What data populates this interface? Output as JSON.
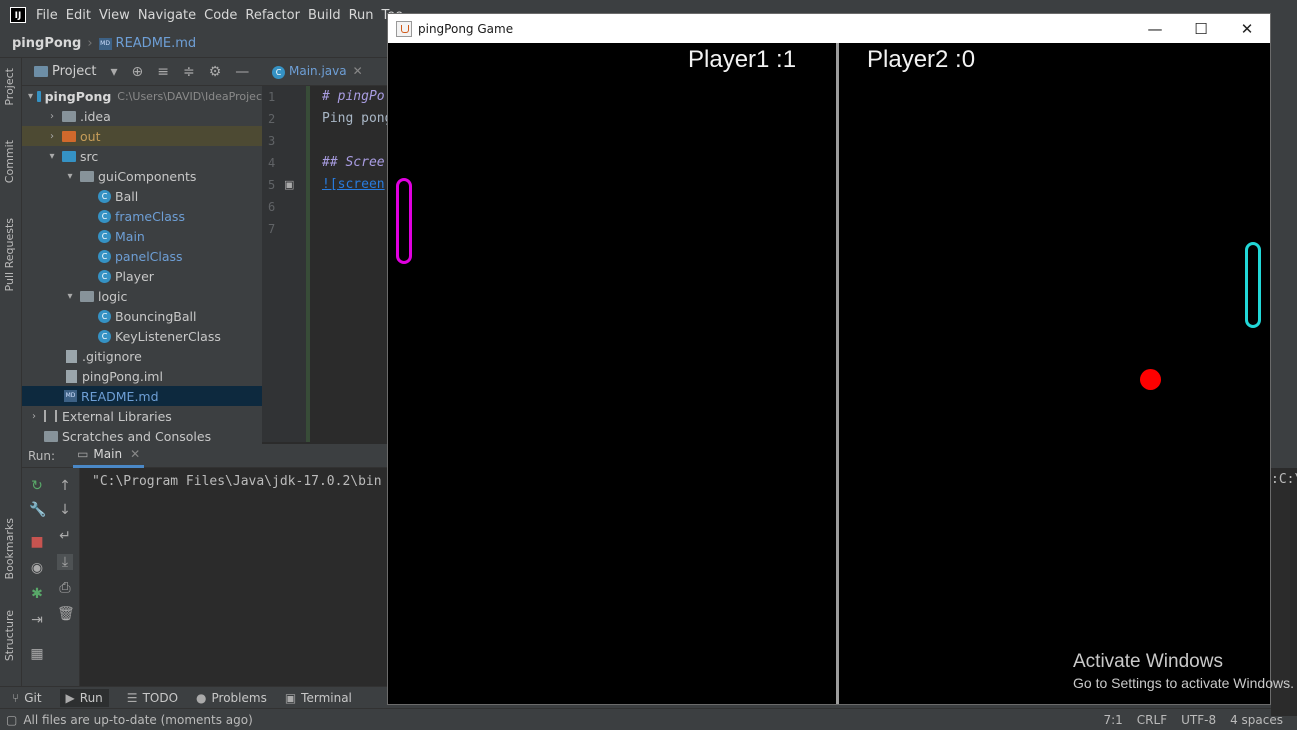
{
  "ide": {
    "menu": [
      "File",
      "Edit",
      "View",
      "Navigate",
      "Code",
      "Refactor",
      "Build",
      "Run",
      "Too"
    ],
    "nav": {
      "project": "pingPong",
      "file": "README.md"
    },
    "left_tabs": [
      "Project",
      "Commit",
      "Pull Requests",
      "Bookmarks",
      "Structure"
    ],
    "project_panel": {
      "title": "Project",
      "tree": [
        {
          "label": "pingPong",
          "path": "C:\\Users\\DAVID\\IdeaProjec",
          "level": 0
        },
        {
          "label": ".idea",
          "level": 1
        },
        {
          "label": "out",
          "level": 1
        },
        {
          "label": "src",
          "level": 1
        },
        {
          "label": "guiComponents",
          "level": 2
        },
        {
          "label": "Ball",
          "level": 3
        },
        {
          "label": "frameClass",
          "level": 3
        },
        {
          "label": "Main",
          "level": 3
        },
        {
          "label": "panelClass",
          "level": 3
        },
        {
          "label": "Player",
          "level": 3
        },
        {
          "label": "logic",
          "level": 2
        },
        {
          "label": "BouncingBall",
          "level": 3
        },
        {
          "label": "KeyListenerClass",
          "level": 3
        },
        {
          "label": ".gitignore",
          "level": 1
        },
        {
          "label": "pingPong.iml",
          "level": 1
        },
        {
          "label": "README.md",
          "level": 1
        },
        {
          "label": "External Libraries",
          "level": 0
        },
        {
          "label": "Scratches and Consoles",
          "level": 0
        }
      ]
    },
    "editor": {
      "tab": "Main.java",
      "line_numbers": [
        "1",
        "2",
        "3",
        "4",
        "5",
        "6",
        "7"
      ],
      "lines": [
        "# pingPo",
        "Ping pong",
        "",
        "## Scree",
        "![screen",
        "",
        ""
      ]
    },
    "run": {
      "label": "Run:",
      "tab": "Main",
      "console": "\"C:\\Program Files\\Java\\jdk-17.0.2\\bin",
      "console_tail": ":C:\\"
    },
    "bottom_tabs": [
      "Git",
      "Run",
      "TODO",
      "Problems",
      "Terminal"
    ],
    "status": {
      "message": "All files are up-to-date (moments ago)",
      "position": "7:1",
      "line_sep": "CRLF",
      "encoding": "UTF-8",
      "indent": "4 spaces"
    }
  },
  "game": {
    "window_title": "pingPong Game",
    "player1_score": "Player1 :1",
    "player2_score": "Player2 :0",
    "colors": {
      "background": "#000000",
      "divider": "#9c9c9c",
      "paddle1": "#e000e0",
      "paddle2": "#22d8d8",
      "ball": "#ff0000"
    }
  },
  "watermark": {
    "line1": "Activate Windows",
    "line2": "Go to Settings to activate Windows."
  }
}
